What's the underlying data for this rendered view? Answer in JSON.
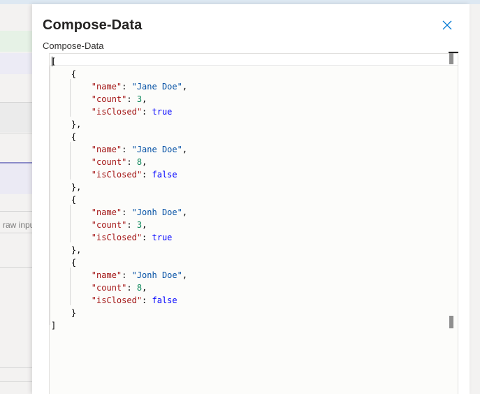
{
  "background": {
    "partial_text": "raw input"
  },
  "panel": {
    "title": "Compose-Data",
    "field_label": "Compose-Data",
    "close_icon": "close-icon"
  },
  "editor": {
    "language": "json",
    "lines": [
      [
        [
          "p",
          "["
        ]
      ],
      [
        [
          "p",
          "    {"
        ]
      ],
      [
        [
          "p",
          "        "
        ],
        [
          "k",
          "\"name\""
        ],
        [
          "p",
          ": "
        ],
        [
          "s",
          "\"Jane Doe\""
        ],
        [
          "p",
          ","
        ]
      ],
      [
        [
          "p",
          "        "
        ],
        [
          "k",
          "\"count\""
        ],
        [
          "p",
          ": "
        ],
        [
          "n",
          "3"
        ],
        [
          "p",
          ","
        ]
      ],
      [
        [
          "p",
          "        "
        ],
        [
          "k",
          "\"isClosed\""
        ],
        [
          "p",
          ": "
        ],
        [
          "b",
          "true"
        ]
      ],
      [
        [
          "p",
          "    },"
        ]
      ],
      [
        [
          "p",
          "    {"
        ]
      ],
      [
        [
          "p",
          "        "
        ],
        [
          "k",
          "\"name\""
        ],
        [
          "p",
          ": "
        ],
        [
          "s",
          "\"Jane Doe\""
        ],
        [
          "p",
          ","
        ]
      ],
      [
        [
          "p",
          "        "
        ],
        [
          "k",
          "\"count\""
        ],
        [
          "p",
          ": "
        ],
        [
          "n",
          "8"
        ],
        [
          "p",
          ","
        ]
      ],
      [
        [
          "p",
          "        "
        ],
        [
          "k",
          "\"isClosed\""
        ],
        [
          "p",
          ": "
        ],
        [
          "b",
          "false"
        ]
      ],
      [
        [
          "p",
          "    },"
        ]
      ],
      [
        [
          "p",
          "    {"
        ]
      ],
      [
        [
          "p",
          "        "
        ],
        [
          "k",
          "\"name\""
        ],
        [
          "p",
          ": "
        ],
        [
          "s",
          "\"Jonh Doe\""
        ],
        [
          "p",
          ","
        ]
      ],
      [
        [
          "p",
          "        "
        ],
        [
          "k",
          "\"count\""
        ],
        [
          "p",
          ": "
        ],
        [
          "n",
          "3"
        ],
        [
          "p",
          ","
        ]
      ],
      [
        [
          "p",
          "        "
        ],
        [
          "k",
          "\"isClosed\""
        ],
        [
          "p",
          ": "
        ],
        [
          "b",
          "true"
        ]
      ],
      [
        [
          "p",
          "    },"
        ]
      ],
      [
        [
          "p",
          "    {"
        ]
      ],
      [
        [
          "p",
          "        "
        ],
        [
          "k",
          "\"name\""
        ],
        [
          "p",
          ": "
        ],
        [
          "s",
          "\"Jonh Doe\""
        ],
        [
          "p",
          ","
        ]
      ],
      [
        [
          "p",
          "        "
        ],
        [
          "k",
          "\"count\""
        ],
        [
          "p",
          ": "
        ],
        [
          "n",
          "8"
        ],
        [
          "p",
          ","
        ]
      ],
      [
        [
          "p",
          "        "
        ],
        [
          "k",
          "\"isClosed\""
        ],
        [
          "p",
          ": "
        ],
        [
          "b",
          "false"
        ]
      ],
      [
        [
          "p",
          "    }"
        ]
      ],
      [
        [
          "p",
          "]"
        ]
      ]
    ]
  },
  "colors": {
    "key": "#a31515",
    "string": "#0451a5",
    "number": "#098658",
    "boolean": "#0000ff",
    "accent": "#0078d4"
  }
}
